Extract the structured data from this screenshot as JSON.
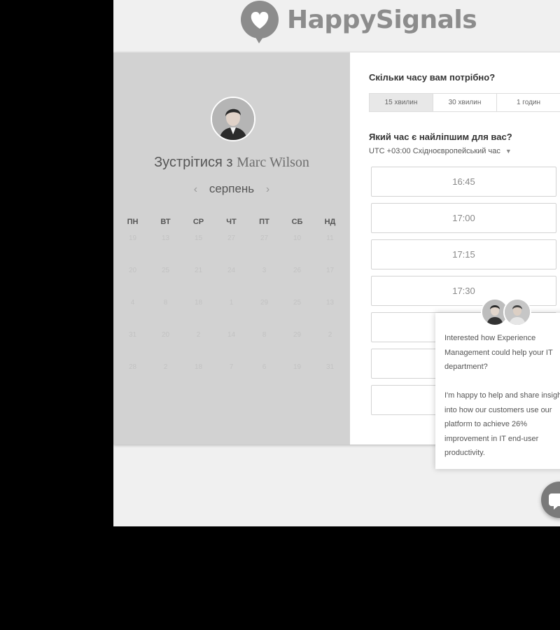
{
  "brand": {
    "name": "HappySignals"
  },
  "left_panel": {
    "meet_prefix": "Зустрітися з",
    "person_name": "Marc Wilson",
    "month": "серпень",
    "weekdays": [
      "ПН",
      "ВТ",
      "СР",
      "ЧТ",
      "ПТ",
      "СБ",
      "НД"
    ],
    "weeks": [
      [
        "19",
        "13",
        "15",
        "27",
        "27",
        "10",
        "11"
      ],
      [
        "20",
        "25",
        "21",
        "24",
        "3",
        "26",
        "17"
      ],
      [
        "4",
        "8",
        "18",
        "1",
        "29",
        "25",
        "13"
      ],
      [
        "31",
        "20",
        "2",
        "14",
        "8",
        "29",
        "2"
      ],
      [
        "28",
        "2",
        "18",
        "7",
        "6",
        "19",
        "31"
      ]
    ]
  },
  "right_panel": {
    "duration_question": "Скільки часу вам потрібно?",
    "durations": [
      "15 хвилин",
      "30 хвилин",
      "1 годин"
    ],
    "time_question": "Який час є найліпшим для вас?",
    "timezone_offset": "UTC +03:00",
    "timezone_name": "Східноєвропейський час",
    "time_slots": [
      "16:45",
      "17:00",
      "17:15",
      "17:30",
      "",
      "",
      ""
    ]
  },
  "chat_popup": {
    "message": "Interested how Experience Management could help your IT department?\n\nI'm happy to help and share insight into how our customers use our platform to achieve 26% improvement in IT end-user productivity."
  },
  "colors": {
    "page_bg": "#f0f0f0",
    "left_panel_bg": "#d2d2d2",
    "brand_gray": "#8c8c8c",
    "outer_bg": "#000000"
  },
  "icons": {
    "logo": "heart-speech-bubble-icon",
    "chat_button": "chat-bubble-icon",
    "timezone_caret": "caret-down-icon",
    "month_prev": "chevron-left-icon",
    "month_next": "chevron-right-icon"
  }
}
